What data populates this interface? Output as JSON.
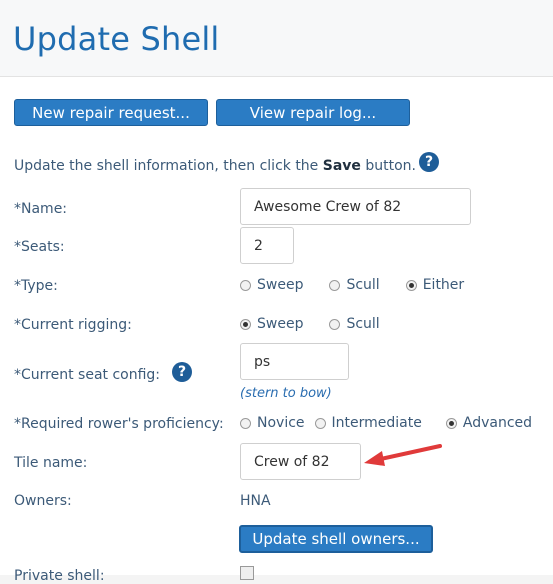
{
  "page": {
    "title": "Update Shell"
  },
  "toolbar": {
    "new_repair_label": "New repair request...",
    "view_log_label": "View repair log..."
  },
  "intro": {
    "before": "Update the shell information, then click the ",
    "bold": "Save",
    "after": " button."
  },
  "help_glyph": "?",
  "form": {
    "name": {
      "label": "*Name:",
      "value": "Awesome Crew of 82"
    },
    "seats": {
      "label": "*Seats:",
      "value": "2"
    },
    "type": {
      "label": "*Type:",
      "options": [
        "Sweep",
        "Scull",
        "Either"
      ],
      "selected": "Either"
    },
    "rigging": {
      "label": "*Current rigging:",
      "options": [
        "Sweep",
        "Scull"
      ],
      "selected": "Sweep"
    },
    "seat_config": {
      "label": "*Current seat config:",
      "value": "ps",
      "hint": "(stern to bow)"
    },
    "proficiency": {
      "label": "*Required rower's proficiency:",
      "options": [
        "Novice",
        "Intermediate",
        "Advanced"
      ],
      "selected": "Advanced"
    },
    "tile_name": {
      "label": "Tile name:",
      "value": "Crew of 82"
    },
    "owners": {
      "label": "Owners:",
      "value": "HNA",
      "update_label": "Update shell owners..."
    },
    "private": {
      "label": "Private shell:"
    }
  },
  "colors": {
    "accent": "#2b7cc4",
    "title": "#1f6cb0",
    "arrow": "#e03a3a"
  }
}
